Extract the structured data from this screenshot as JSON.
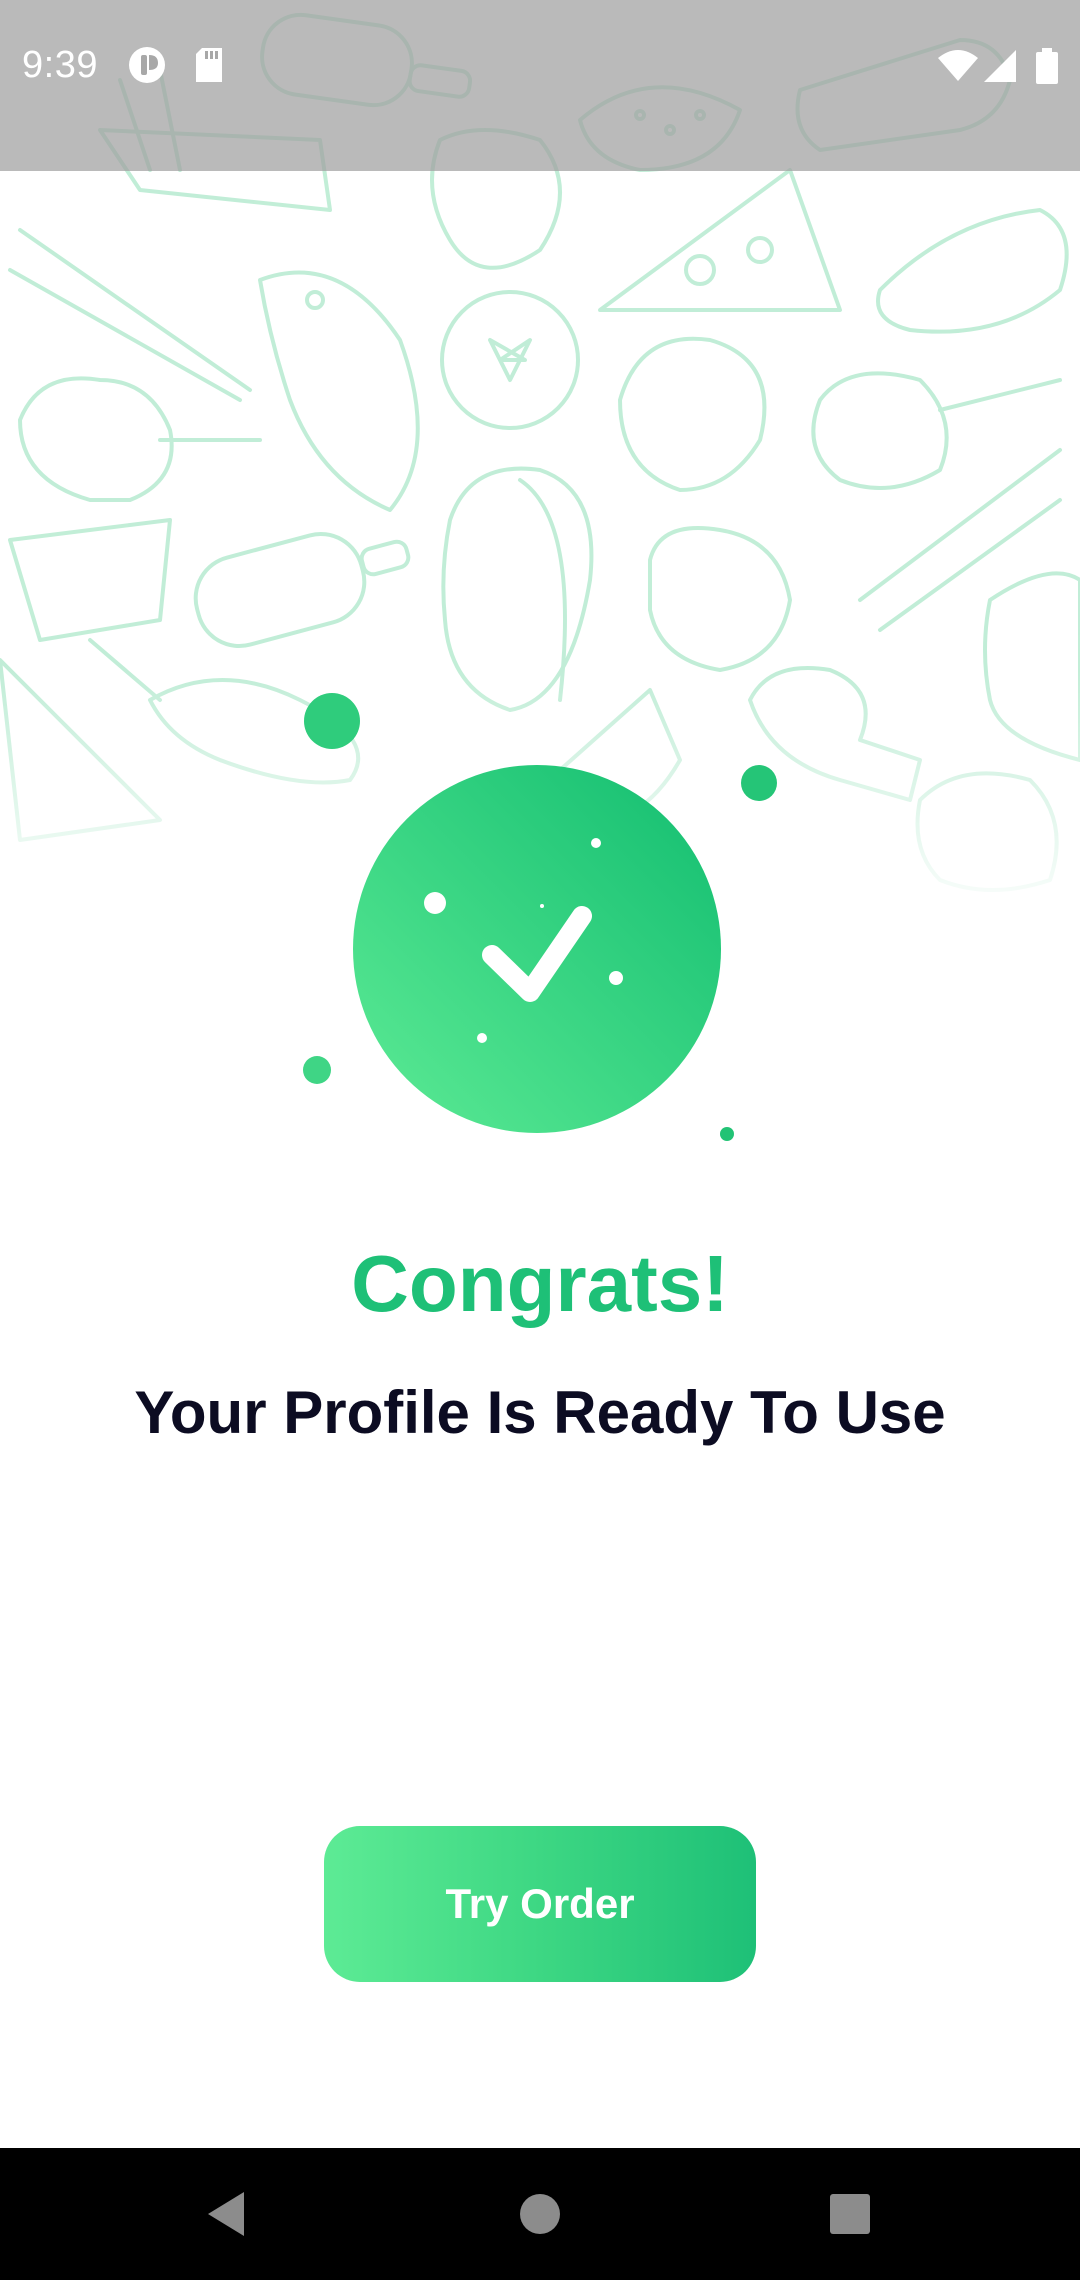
{
  "status_bar": {
    "time": "9:39",
    "left_icons": [
      "notification-app-icon",
      "sd-card-icon"
    ],
    "right_icons": [
      "wifi-icon",
      "cellular-signal-icon",
      "battery-icon"
    ]
  },
  "hero": {
    "illustration": "check-circle-icon",
    "accent_color": "#1ec077",
    "accent_light": "#5deb95"
  },
  "content": {
    "title": "Congrats!",
    "subtitle": "Your Profile Is Ready To Use"
  },
  "actions": {
    "primary_label": "Try Order"
  },
  "nav_bar": {
    "buttons": [
      "back-icon",
      "home-icon",
      "recents-icon"
    ]
  }
}
